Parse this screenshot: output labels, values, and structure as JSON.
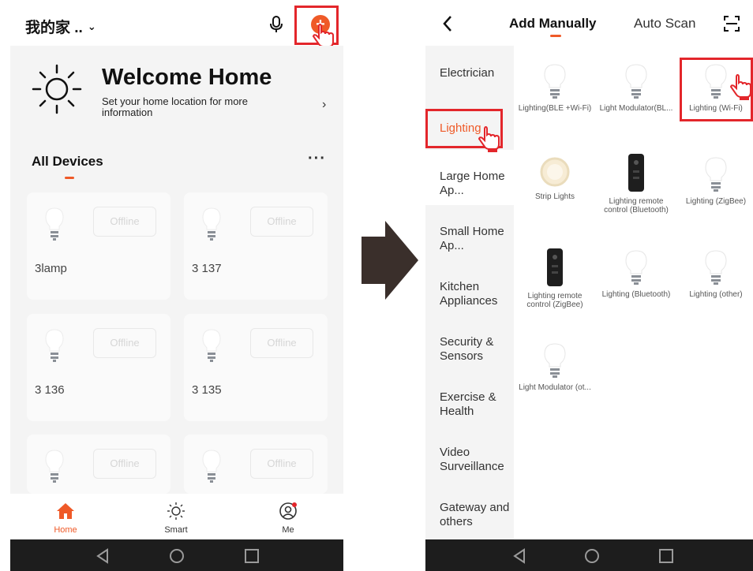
{
  "left_screen": {
    "home_name": "我的家 ..",
    "welcome": {
      "title": "Welcome Home",
      "subtitle": "Set your home location for more information"
    },
    "section_title": "All Devices",
    "devices": [
      {
        "name": "3lamp",
        "status": "Offline"
      },
      {
        "name": "3 137",
        "status": "Offline"
      },
      {
        "name": "3 136",
        "status": "Offline"
      },
      {
        "name": "3 135",
        "status": "Offline"
      },
      {
        "name": "",
        "status": "Offline"
      },
      {
        "name": "",
        "status": "Offline"
      }
    ],
    "tabs": [
      {
        "label": "Home",
        "icon": "home-icon",
        "active": true
      },
      {
        "label": "Smart",
        "icon": "sun-icon",
        "active": false
      },
      {
        "label": "Me",
        "icon": "user-icon",
        "active": false
      }
    ]
  },
  "right_screen": {
    "tabs": {
      "manual": "Add Manually",
      "auto": "Auto Scan"
    },
    "categories": [
      "Electrician",
      "Lighting",
      "Large Home Ap...",
      "Small Home Ap...",
      "Kitchen Appliances",
      "Security & Sensors",
      "Exercise & Health",
      "Video Surveillance",
      "Gateway and others"
    ],
    "products": [
      {
        "label": "Lighting(BLE +Wi-Fi)",
        "icon": "bulb-icon"
      },
      {
        "label": "Light Modulator(BL...",
        "icon": "bulb-icon"
      },
      {
        "label": "Lighting (Wi-Fi)",
        "icon": "bulb-icon"
      },
      {
        "label": "Strip Lights",
        "icon": "strip-lights-icon"
      },
      {
        "label": "Lighting remote control (Bluetooth)",
        "icon": "remote-icon"
      },
      {
        "label": "Lighting (ZigBee)",
        "icon": "bulb-icon"
      },
      {
        "label": "Lighting remote control (ZigBee)",
        "icon": "remote-icon"
      },
      {
        "label": "Lighting (Bluetooth)",
        "icon": "bulb-icon"
      },
      {
        "label": "Lighting (other)",
        "icon": "bulb-icon"
      },
      {
        "label": "Light Modulator (ot...",
        "icon": "bulb-icon"
      }
    ]
  },
  "colors": {
    "accent": "#ef5a28",
    "highlight": "#e3262b",
    "background": "#f4f4f4",
    "nav_bar": "#1d1d1d"
  }
}
